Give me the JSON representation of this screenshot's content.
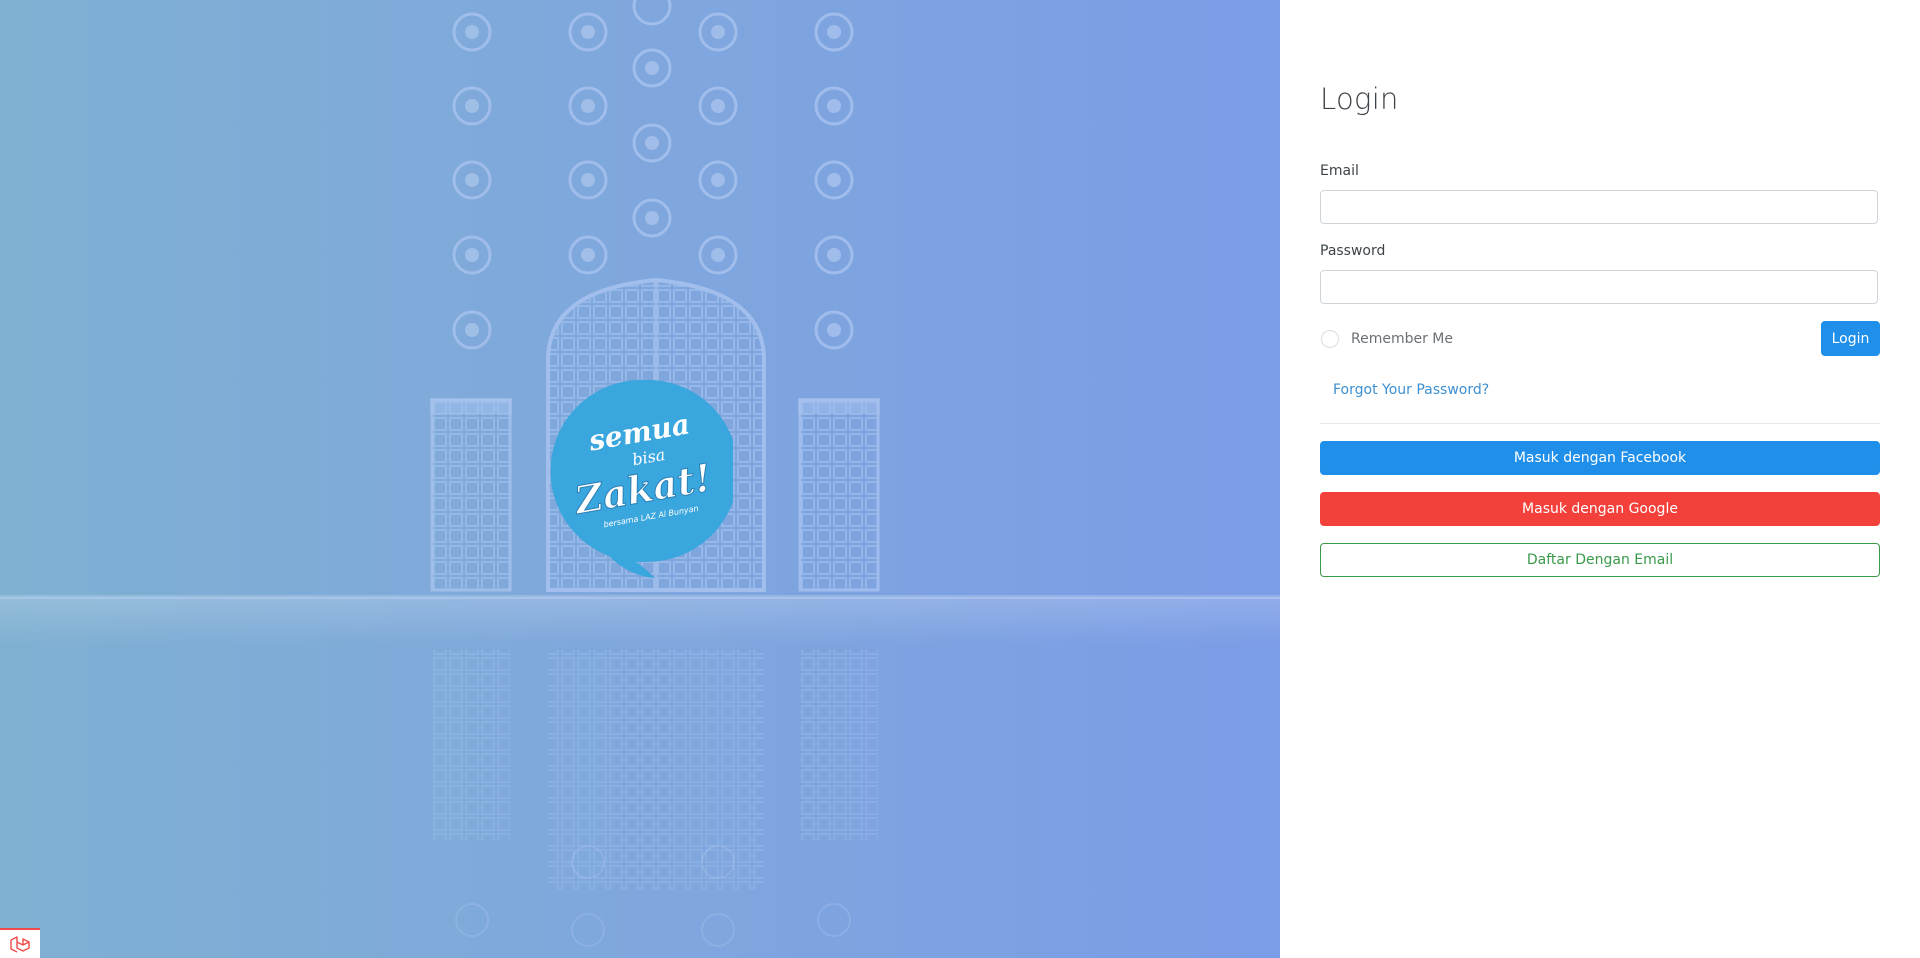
{
  "hero": {
    "logo": {
      "line1": "semua",
      "line2": "bisa",
      "line3": "Zakat!",
      "tagline": "bersama LAZ Al Bunyan",
      "color": "#3aa6de"
    },
    "overlay_color_left": "#7fb0d2",
    "overlay_color_right": "#7b9ce6",
    "corner_badge_icon": "laravel-icon"
  },
  "login": {
    "title": "Login",
    "email_label": "Email",
    "email_value": "",
    "password_label": "Password",
    "password_value": "",
    "remember_label": "Remember Me",
    "submit_label": "Login",
    "forgot_label": "Forgot Your Password?"
  },
  "social": {
    "facebook_label": "Masuk dengan Facebook",
    "google_label": "Masuk dengan Google",
    "register_label": "Daftar Dengan Email"
  },
  "colors": {
    "primary": "#1f8fea",
    "google": "#f4403a",
    "register": "#3a9a4a",
    "link": "#3d8fd1"
  }
}
